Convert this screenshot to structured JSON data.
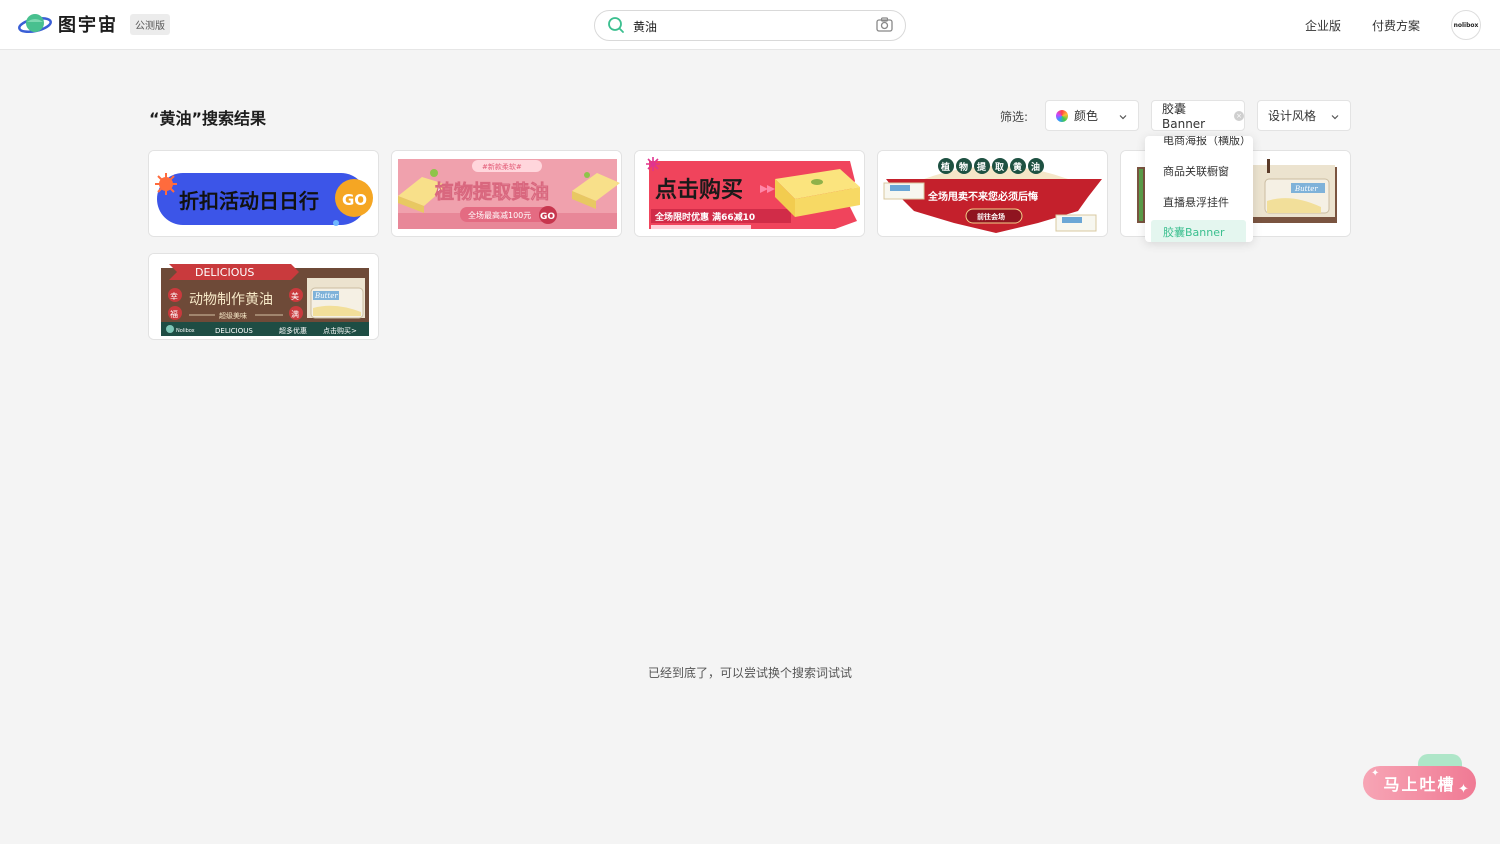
{
  "header": {
    "logo_text": "图宇宙",
    "beta_badge": "公测版",
    "search": {
      "value": "黄油",
      "placeholder": ""
    },
    "nav": {
      "enterprise": "企业版",
      "pricing": "付费方案"
    },
    "avatar_text": "nolibox"
  },
  "results": {
    "title": "“黄油”搜索结果",
    "filter_label": "筛选:",
    "filters": {
      "color": "颜色",
      "banner": "胶囊Banner",
      "style": "设计风格"
    },
    "dropdown": {
      "items": [
        "电商海报（横版）",
        "商品关联橱窗",
        "直播悬浮挂件",
        "胶囊Banner"
      ],
      "active_index": 3
    }
  },
  "cards": [
    {
      "main_text": "折扣活动日日行",
      "cta": "GO"
    },
    {
      "tag": "#新款柔软#",
      "main_text": "植物提取黄油",
      "sub_text": "全场最高减100元",
      "cta": "GO"
    },
    {
      "main_text": "点击购买",
      "sub_text": "全场限时优惠 满66减10"
    },
    {
      "title_chars": [
        "植",
        "物",
        "提",
        "取",
        "黄",
        "油"
      ],
      "main_text": "全场甩卖不来您必须后悔",
      "cta": "前往会场"
    },
    {
      "label": "Butter"
    },
    {
      "ribbon": "DELICIOUS",
      "main_text": "动物制作黄油",
      "sub_text": "超级美味",
      "side_left": [
        "幸",
        "福"
      ],
      "side_right": [
        "美",
        "满"
      ],
      "footer_left": "DELICIOUS",
      "footer_mid": "超多优惠",
      "footer_right": "点击购买>",
      "label": "Butter",
      "brand": "Nolibox"
    }
  ],
  "end_text": "已经到底了，可以尝试换个搜索词试试",
  "feedback": {
    "label": "马上吐槽"
  },
  "colors": {
    "accent": "#3bbf8f",
    "card1_bg": "#3c55e8",
    "card1_go": "#f5a623",
    "card2_bg": "#f0a1ad",
    "card3_bg": "#f0445c",
    "card4_bg": "#c4202c",
    "card6_bg": "#6e4a38",
    "feedback": "#f07a94"
  }
}
